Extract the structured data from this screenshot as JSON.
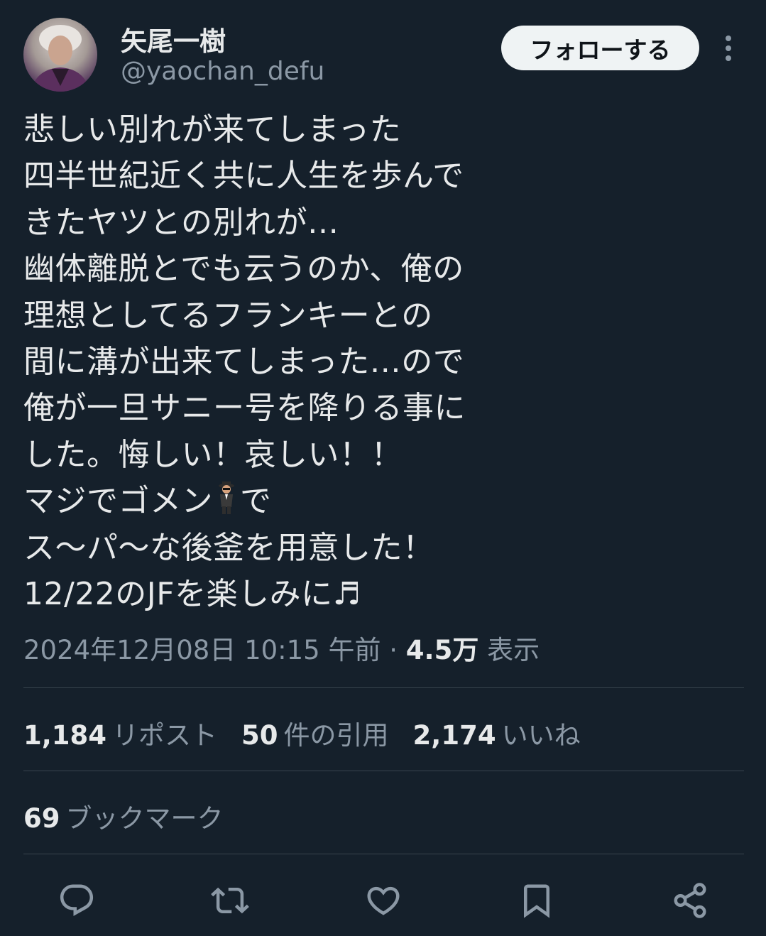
{
  "user": {
    "display_name": "矢尾一樹",
    "handle": "@yaochan_defu"
  },
  "follow_button_label": "フォローする",
  "tweet": {
    "lines": [
      "悲しい別れが来てしまった",
      "四半世紀近く共に人生を歩んで",
      "きたヤツとの別れが…",
      "幽体離脱とでも云うのか、俺の",
      "理想としてるフランキーとの",
      "間に溝が出来てしまった…ので",
      "俺が一旦サニー号を降りる事に",
      "した。悔しい！哀しい！！",
      "マジでゴメン",
      "で",
      "ス〜パ〜な後釜を用意した！",
      "12/22のJFを楽しみに♬"
    ]
  },
  "meta": {
    "timestamp": "2024年12月08日 10:15 午前",
    "separator": "·",
    "views_count": "4.5万",
    "views_label": "表示"
  },
  "stats": {
    "reposts_count": "1,184",
    "reposts_label": "リポスト",
    "quotes_count": "50",
    "quotes_label": "件の引用",
    "likes_count": "2,174",
    "likes_label": "いいね"
  },
  "bookmarks": {
    "count": "69",
    "label": "ブックマーク"
  },
  "icons": {
    "reply": "reply-icon",
    "repost": "repost-icon",
    "like": "heart-icon",
    "bookmark": "bookmark-icon",
    "share": "share-icon",
    "more": "more-vertical-icon",
    "emoji": "man-in-business-suit-levitating-icon"
  },
  "colors": {
    "background": "#15202b",
    "text": "#e7e9ea",
    "secondary_text": "#8b98a5",
    "divider": "#38444d",
    "button_bg": "#eff3f4"
  }
}
